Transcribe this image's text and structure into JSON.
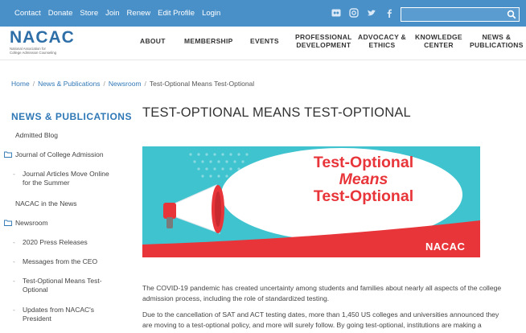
{
  "topbar": {
    "links": [
      "Contact",
      "Donate",
      "Store",
      "Join",
      "Renew",
      "Edit Profile",
      "Login"
    ],
    "social_icons": [
      "flickr-icon",
      "instagram-icon",
      "twitter-icon",
      "facebook-icon"
    ],
    "search_placeholder": ""
  },
  "header": {
    "logo_word": "NACAC",
    "logo_sub_line1": "National Association for",
    "logo_sub_line2": "College Admission Counseling",
    "nav": [
      {
        "l1": "ABOUT",
        "l2": ""
      },
      {
        "l1": "MEMBERSHIP",
        "l2": ""
      },
      {
        "l1": "EVENTS",
        "l2": ""
      },
      {
        "l1": "PROFESSIONAL",
        "l2": "DEVELOPMENT"
      },
      {
        "l1": "ADVOCACY &",
        "l2": "ETHICS"
      },
      {
        "l1": "KNOWLEDGE",
        "l2": "CENTER"
      },
      {
        "l1": "NEWS &",
        "l2": "PUBLICATIONS"
      }
    ]
  },
  "breadcrumb": {
    "home": "Home",
    "news": "News & Publications",
    "newsroom": "Newsroom",
    "current": "Test-Optional Means Test-Optional"
  },
  "sidebar": {
    "title": "NEWS & PUBLICATIONS",
    "items": {
      "admitted_blog": "Admitted Blog",
      "journal": "Journal of College Admission",
      "journal_articles_l1": "Journal Articles Move Online",
      "journal_articles_l2": "for the Summer",
      "in_news": "NACAC in the News",
      "newsroom": "Newsroom",
      "press": "2020 Press Releases",
      "ceo": "Messages from the CEO",
      "tomto_l1": "Test-Optional Means Test-",
      "tomto_l2": "Optional",
      "updates_l1": "Updates from NACAC's",
      "updates_l2": "President"
    }
  },
  "main": {
    "title": "TEST-OPTIONAL MEANS TEST-OPTIONAL",
    "hero": {
      "line1": "Test-Optional",
      "line2": "Means",
      "line3": "Test-Optional",
      "logo": "NACAC",
      "colors": {
        "teal": "#3fc4cf",
        "red": "#e8353a",
        "white": "#ffffff"
      }
    },
    "para1_l1": "The COVID-19 pandemic has created uncertainty among students and families about nearly all aspects of the college",
    "para1_l2": "admission process, including the role of standardized testing.",
    "para2_l1": "Due to the cancellation of SAT and ACT testing dates, more than 1,450 US colleges and universities announced they",
    "para2_l2": "are moving to a test-optional policy, and more will surely follow. By going test-optional, institutions are making a"
  }
}
